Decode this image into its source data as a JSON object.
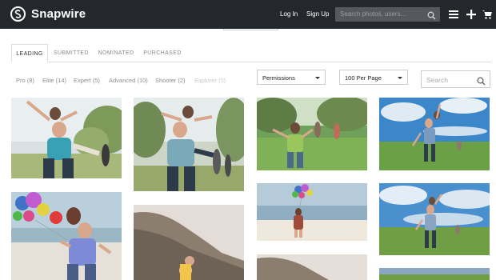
{
  "brand": {
    "name": "Snapwire"
  },
  "topnav": {
    "login": "Log In",
    "signup": "Sign Up",
    "search_placeholder": "Search photos, users..."
  },
  "tabs": [
    {
      "label": "LEADING",
      "active": true
    },
    {
      "label": "SUBMITTED",
      "active": false
    },
    {
      "label": "NOMINATED",
      "active": false
    },
    {
      "label": "PURCHASED",
      "active": false
    }
  ],
  "filters": [
    {
      "label": "Pro (8)",
      "enabled": true
    },
    {
      "label": "Elite (14)",
      "enabled": true
    },
    {
      "label": "Expert (5)",
      "enabled": true
    },
    {
      "label": "Advanced (10)",
      "enabled": true
    },
    {
      "label": "Shooter (2)",
      "enabled": true
    },
    {
      "label": "Explorer (0)",
      "enabled": false
    }
  ],
  "selects": {
    "permissions": "Permissions",
    "per_page": "100 Per Page"
  },
  "search": {
    "placeholder": "Search"
  },
  "icons": {
    "top": [
      "menu-icon",
      "plus-icon",
      "cart-icon"
    ],
    "search": "magnifier-icon"
  },
  "colors": {
    "topbar": "#24272c",
    "search_top": "#55595f"
  },
  "photos": [
    {
      "column": 1,
      "scene": "piggyback-tree-park"
    },
    {
      "column": 1,
      "scene": "piggyback-beach-balloons"
    },
    {
      "column": 2,
      "scene": "piggyback-trees"
    },
    {
      "column": 2,
      "scene": "hill-rocks"
    },
    {
      "column": 3,
      "scene": "running-field"
    },
    {
      "column": 3,
      "scene": "beach-balloons"
    },
    {
      "column": 3,
      "scene": "hill-rocks-small"
    },
    {
      "column": 4,
      "scene": "piggyback-meadow-sky"
    },
    {
      "column": 4,
      "scene": "piggyback-meadow-clouds"
    },
    {
      "column": 4,
      "scene": "partial-meadow"
    }
  ]
}
